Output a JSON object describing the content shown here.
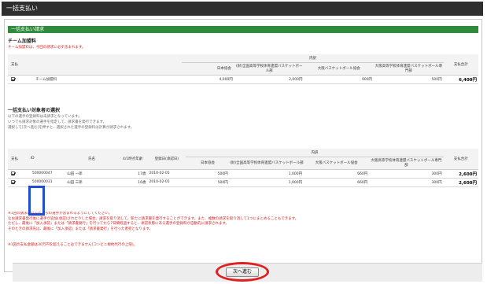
{
  "titlebar": {
    "title": "一括支払い"
  },
  "subbar": {
    "title": "一括支払い請求"
  },
  "team_fee_section": {
    "title": "チーム加盟料",
    "note": "チーム加盟料は、今回の請求に必ず含まれます。",
    "headers": {
      "pay": "支払",
      "breakdown": "内訳",
      "col1": "日本協会",
      "col2": "(財)全国高等学校体育連盟バスケットボール部",
      "col3": "大阪バスケットボール協会",
      "col4": "大阪高等学校体育連盟バスケットボール専門部",
      "total": "支払合計"
    },
    "row": {
      "checked": true,
      "name": "チーム加盟料",
      "col1": "4,000円",
      "col2": "2,000円",
      "col3": "900円",
      "col4": "500円",
      "total": "6,400円"
    }
  },
  "member_section": {
    "title": "一括支払い対象者の選択",
    "notes": [
      "以下の選手の登録料は未請求となっています。",
      "いつでも請求対象の選手を指定して、請求書を発行できます。",
      "選択して[次へ進む]を押すと、選択された選手の登録料は計算が請求されます。"
    ],
    "headers": {
      "pay": "支払",
      "id": "ID",
      "name": "氏名",
      "age": "4/1時点年齢",
      "date": "登録日(承認日)",
      "breakdown": "内訳",
      "col1": "日本協会",
      "col2": "(財)全国高等学校体育連盟バスケットボール部",
      "col3": "大阪バスケットボール協会",
      "col4": "大阪高等学校体育連盟バスケットボール専門部",
      "total": "支払合計"
    },
    "rows": [
      {
        "checked": true,
        "id": "500000047",
        "name": "山田 一郎",
        "age": "17歳",
        "date": "2010-02-05",
        "col1": "500円",
        "col2": "1,000円",
        "col3": "660円",
        "col4": "300円",
        "total": "2,600円"
      },
      {
        "checked": true,
        "id": "500000031",
        "name": "山田 三郎",
        "age": "16歳",
        "date": "2010-02-05",
        "col1": "500円",
        "col2": "1,000円",
        "col3": "660円",
        "col4": "300円",
        "total": "2,600円"
      }
    ]
  },
  "warnings": [
    "※1回の請求になるべくちの選手が含まれるようにしてください。",
    "なお請求書発行後に選手が追加(承認)されたりした場合、請求を取り消して、新たに請求書を発行することができます。また、複数の請求を取り消して1つにまとめることもできます。",
    "ただし、最後に「加入承認」または「請求書発行」を行ってから7日間経過すると、承認状態にある選手の登録料が自動的に請求されます。",
    "そのときの請求先は、最後に「加入承認」または「請求書発行」を行った者宛となります。"
  ],
  "limit_note": "※1回の支払金額は30万円を超えることはできません(コンビニ規約代行の上限)。",
  "footer": {
    "next_label": "次へ進む"
  },
  "colors": {
    "titlebar": "#2f2f2f",
    "subbar": "#2e8b3b",
    "warning": "#d32020",
    "highlight_blue": "#1e4fd2",
    "highlight_red": "#e02020"
  }
}
